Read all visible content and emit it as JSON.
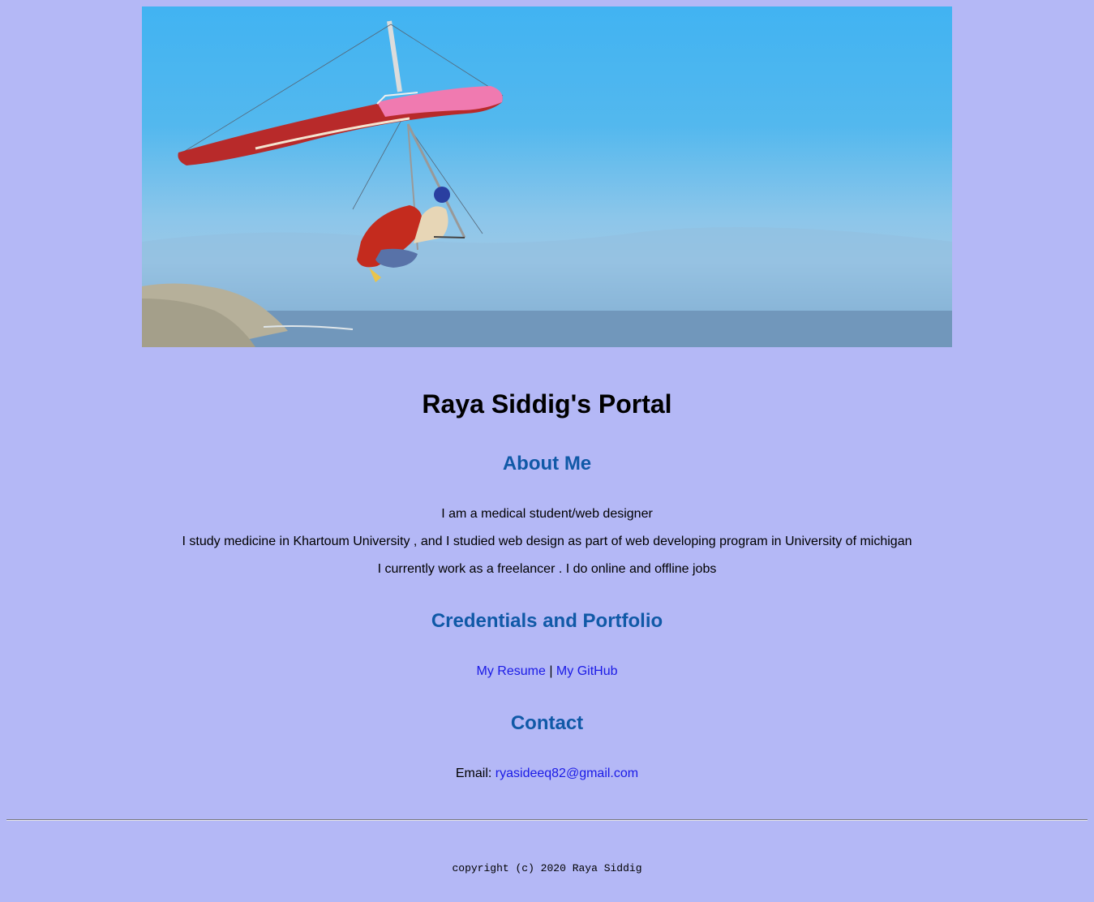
{
  "header": {
    "hero_image": "hang-glider-over-coast"
  },
  "page": {
    "title": "Raya Siddig's Portal"
  },
  "about": {
    "heading": "About Me",
    "line1": "I am a medical student/web designer",
    "line2": "I study medicine in Khartoum University , and I studied web design as part of web developing program in University of michigan",
    "line3": "I currently work as a freelancer . I do online and offline jobs"
  },
  "credentials": {
    "heading": "Credentials and Portfolio",
    "resume_link": "My Resume",
    "separator": "|",
    "github_link": "My GitHub"
  },
  "contact": {
    "heading": "Contact",
    "email_label": "Email:",
    "email_link": "ryasideeq82@gmail.com"
  },
  "footer": {
    "copyright": "copyright (c) 2020 Raya Siddig"
  },
  "colors": {
    "background": "#b4b8f6",
    "heading": "#1059a7",
    "link": "#1a1ae6"
  }
}
